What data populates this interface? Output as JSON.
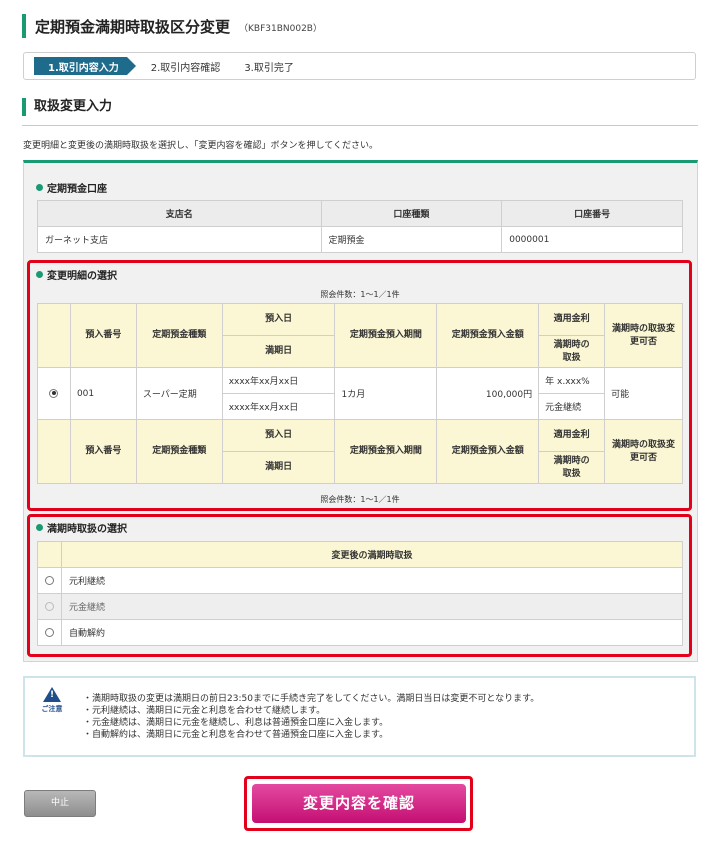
{
  "header": {
    "title": "定期預金満期時取扱区分変更",
    "code": "（KBF31BN002B）"
  },
  "steps": [
    "1.取引内容入力",
    "2.取引内容確認",
    "3.取引完了"
  ],
  "section_title": "取扱変更入力",
  "instruction": "変更明細と変更後の満期時取扱を選択し、「変更内容を確認」ボタンを押してください。",
  "account": {
    "title": "定期預金口座",
    "headers": [
      "支店名",
      "口座種類",
      "口座番号"
    ],
    "row": [
      "ガーネット支店",
      "定期預金",
      "0000001"
    ]
  },
  "detail": {
    "title": "変更明細の選択",
    "count": "照会件数：1～1／1件",
    "headers": {
      "number": "預入番号",
      "type": "定期預金種類",
      "deposit_date": "預入日",
      "maturity_date": "満期日",
      "period": "定期預金預入期間",
      "amount": "定期預金預入金額",
      "rate": "適用金利",
      "maturity_handling": "満期時の取扱",
      "changeable": "満期時の取扱変更可否"
    },
    "row": {
      "number": "001",
      "type": "スーパー定期",
      "deposit_date": "xxxx年xx月xx日",
      "maturity_date": "xxxx年xx月xx日",
      "period": "1カ月",
      "amount": "100,000円",
      "rate": "年 x.xxx%",
      "maturity_handling": "元金継続",
      "changeable": "可能"
    }
  },
  "maturity": {
    "title": "満期時取扱の選択",
    "header": "変更後の満期時取扱",
    "options": [
      "元利継続",
      "元金継続",
      "自動解約"
    ]
  },
  "caution": {
    "label": "ご注意",
    "items": [
      "・満期時取扱の変更は満期日の前日23:50までに手続き完了をしてください。満期日当日は変更不可となります。",
      "・元利継続は、満期日に元金と利息を合わせて継続します。",
      "・元金継続は、満期日に元金を継続し、利息は普通預金口座に入金します。",
      "・自動解約は、満期日に元金と利息を合わせて普通預金口座に入金します。"
    ]
  },
  "buttons": {
    "cancel": "中止",
    "confirm": "変更内容を確認"
  }
}
